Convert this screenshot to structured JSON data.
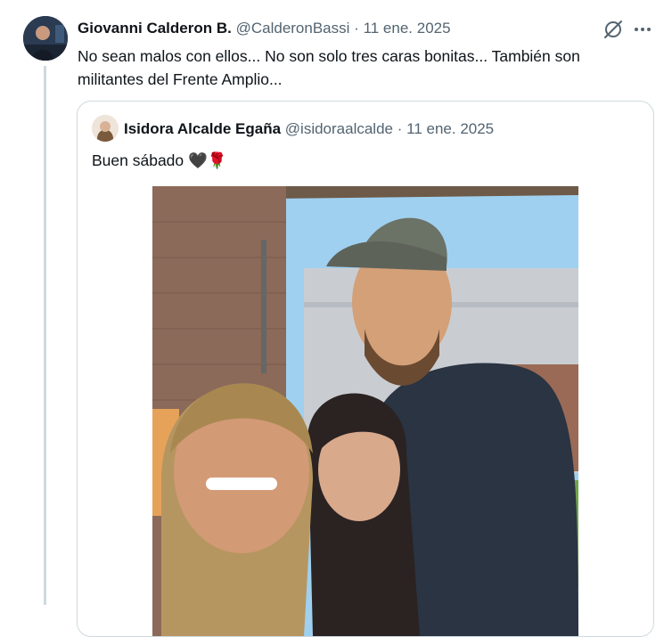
{
  "tweet": {
    "author_name": "Giovanni Calderon B.",
    "handle": "@CalderonBassi",
    "separator": "·",
    "date": "11 ene. 2025",
    "text": "No sean malos con ellos... No son solo tres caras bonitas... También son militantes del Frente Amplio..."
  },
  "quoted": {
    "author_name": "Isidora Alcalde Egaña",
    "handle": "@isidoraalcalde",
    "separator": "·",
    "date": "11 ene. 2025",
    "text": "Buen sábado 🖤🌹"
  },
  "icons": {
    "grok": "grok-icon",
    "more": "more-icon"
  },
  "colors": {
    "text": "#0f1419",
    "muted": "#536471",
    "border": "#cfd9de"
  }
}
